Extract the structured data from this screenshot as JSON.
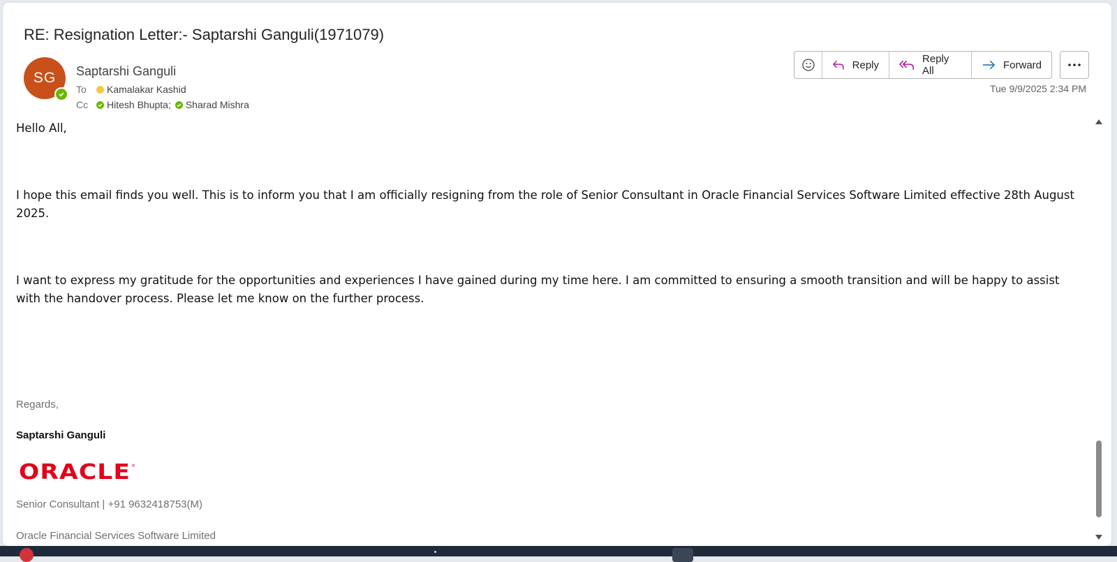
{
  "email": {
    "subject": "RE: Resignation Letter:- Saptarshi Ganguli(1971079)",
    "avatar_initials": "SG",
    "sender_name": "Saptarshi Ganguli",
    "to_label": "To",
    "to": [
      {
        "name": "Kamalakar Kashid",
        "status": "away"
      }
    ],
    "cc_label": "Cc",
    "cc": [
      {
        "name": "Hitesh Bhupta",
        "status": "available"
      },
      {
        "name": "Sharad Mishra",
        "status": "available"
      }
    ],
    "datetime": "Tue 9/9/2025 2:34 PM"
  },
  "actions": {
    "emoji_icon": "smiley-icon",
    "reply_label": "Reply",
    "reply_all_label": "Reply All",
    "forward_label": "Forward",
    "more_icon": "more-horizontal-icon"
  },
  "body": {
    "greeting": "Hello All,",
    "paragraph1": "I hope this email finds you well. This is to inform you that I am officially resigning from the role of Senior Consultant in Oracle Financial Services Software Limited effective 28th August 2025.",
    "paragraph2": "I want to express my gratitude for the opportunities and experiences I have gained during my time here. I am committed to ensuring a smooth transition and will be happy to assist with the handover process. Please let me know on the further process.",
    "regards": "Regards,",
    "signature_name": "Saptarshi Ganguli",
    "logo_text": "ORACLE",
    "signature_title": "Senior Consultant | +91 9632418753(M)",
    "signature_company": "Oracle Financial Services Software Limited"
  },
  "colors": {
    "avatar": "#c8511b",
    "presence_available": "#6bb700",
    "presence_away": "#f8c73b",
    "reply_icon": "#b4009e",
    "forward_icon": "#0f6cbd",
    "oracle_red": "#e3001b"
  }
}
